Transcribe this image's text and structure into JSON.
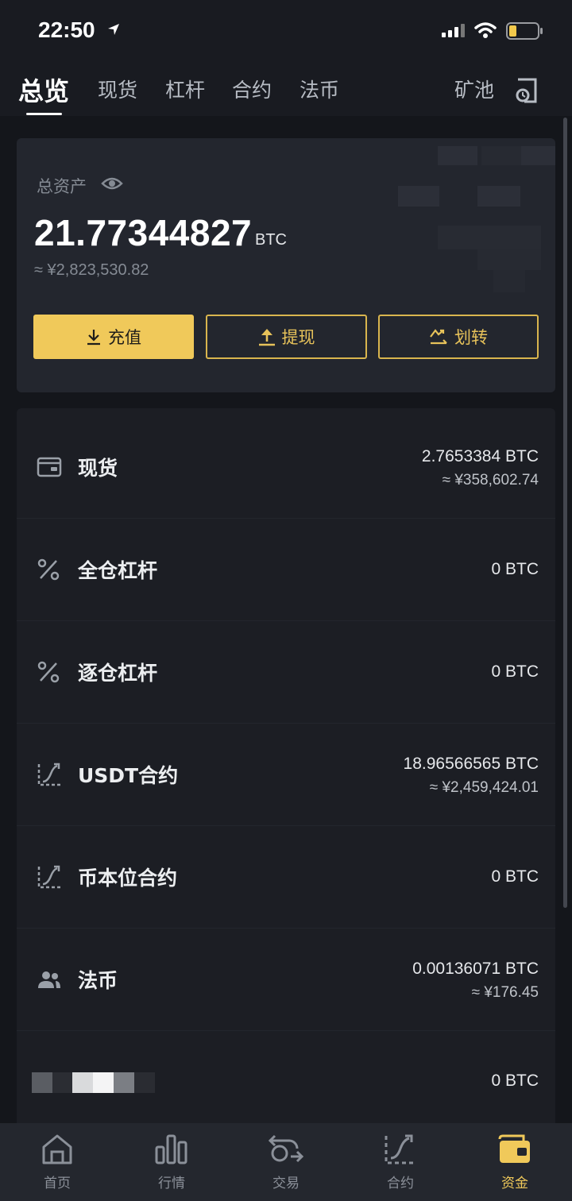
{
  "status_bar": {
    "time": "22:50"
  },
  "top_tabs": {
    "items": [
      "总览",
      "现货",
      "杠杆",
      "合约",
      "法币"
    ],
    "mining": "矿池"
  },
  "asset_card": {
    "label": "总资产",
    "amount": "21.77344827",
    "unit": "BTC",
    "cny": "≈ ¥2,823,530.82",
    "buttons": {
      "deposit": "充值",
      "withdraw": "提现",
      "transfer": "划转"
    }
  },
  "accounts": [
    {
      "name": "现货",
      "icon": "wallet-icon",
      "value": "2.7653384 BTC",
      "cny": "≈ ¥358,602.74"
    },
    {
      "name": "全仓杠杆",
      "icon": "percent-icon",
      "value": "0 BTC",
      "cny": ""
    },
    {
      "name": "逐仓杠杆",
      "icon": "percent-icon",
      "value": "0 BTC",
      "cny": ""
    },
    {
      "name": "USDT合约",
      "icon": "futures-icon",
      "value": "18.96566565 BTC",
      "cny": "≈ ¥2,459,424.01"
    },
    {
      "name": "币本位合约",
      "icon": "futures-icon",
      "value": "0 BTC",
      "cny": ""
    },
    {
      "name": "法币",
      "icon": "users-icon",
      "value": "0.00136071 BTC",
      "cny": "≈ ¥176.45"
    },
    {
      "name": "",
      "icon": "",
      "value": "0 BTC",
      "cny": ""
    }
  ],
  "bottom_nav": {
    "items": [
      "首页",
      "行情",
      "交易",
      "合约",
      "资金"
    ],
    "active": "资金",
    "accent": "#f0c95a"
  }
}
